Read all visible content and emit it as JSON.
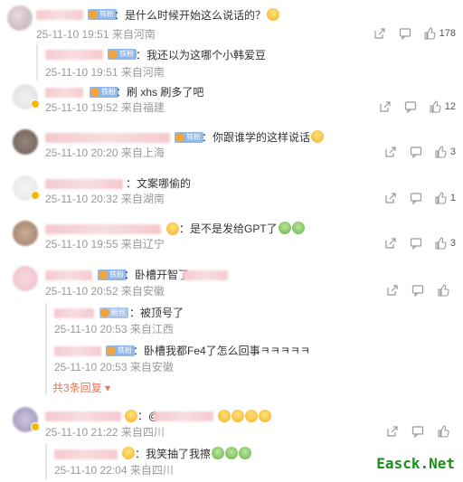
{
  "comments": [
    {
      "text": "：是什么时候开始这么说话的？",
      "time": "25-11-10 19:51",
      "loc": "来自河南",
      "likes": "178",
      "emoji": "yellow"
    },
    {
      "text": "：我还以为这哪个小韩爱豆",
      "time": "25-11-10 19:51",
      "loc": "来自河南"
    },
    {
      "text": "：刷 xhs 刷多了吧",
      "time": "25-11-10 19:52",
      "loc": "来自福建",
      "likes": "12"
    },
    {
      "text": "：你跟谁学的这样说话",
      "time": "25-11-10 20:20",
      "loc": "来自上海",
      "likes": "3"
    },
    {
      "text": "：文案哪偷的",
      "time": "25-11-10 20:32",
      "loc": "来自湖南",
      "likes": "1"
    },
    {
      "text": "：是不是发给GPT了",
      "time": "25-11-10 19:55",
      "loc": "来自辽宁",
      "likes": "3"
    },
    {
      "text": "：卧槽开智了",
      "time": "25-11-10 20:52",
      "loc": "来自安徽"
    },
    {
      "text": "：被顶号了",
      "time": "25-11-10 20:53",
      "loc": "来自江西"
    },
    {
      "text": "：卧槽我都Fe4了怎么回事ㅋㅋㅋㅋㅋ",
      "time": "25-11-10 20:53",
      "loc": "来自安徽"
    },
    {
      "text": "：@",
      "time": "25-11-10 21:22",
      "loc": "来自四川"
    },
    {
      "text": "：我笑抽了我擦",
      "time": "25-11-10 22:04",
      "loc": "来自四川"
    }
  ],
  "more_replies": "共3条回复",
  "more_arrow": "▾",
  "watermark": "Easck.Net"
}
